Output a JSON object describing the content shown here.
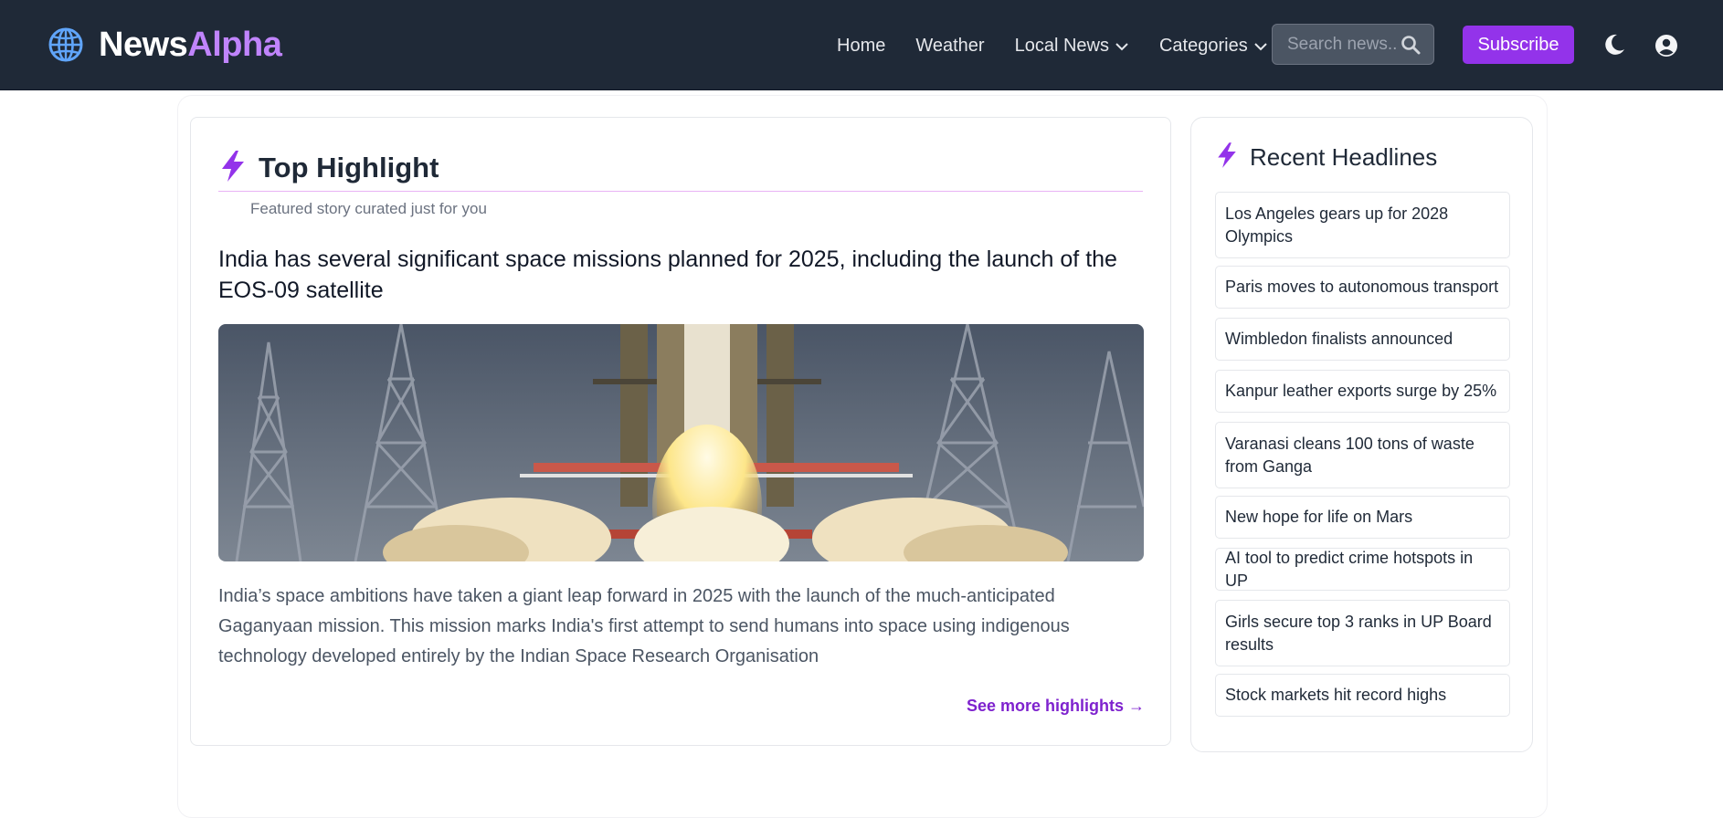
{
  "header": {
    "brand": {
      "part1": "News",
      "part2": "Alpha",
      "icon": "globe-icon"
    },
    "nav": [
      {
        "label": "Home",
        "dropdown": false
      },
      {
        "label": "Weather",
        "dropdown": false
      },
      {
        "label": "Local News",
        "dropdown": true
      },
      {
        "label": "Categories",
        "dropdown": true
      }
    ],
    "search_placeholder": "Search news...",
    "subscribe_label": "Subscribe",
    "icons": {
      "theme": "moon-icon",
      "account": "user-circle-icon",
      "search": "search-icon"
    }
  },
  "main": {
    "section_title": "Top Highlight",
    "section_subtitle": "Featured story curated just for you",
    "story": {
      "title": "India has several significant space missions planned for 2025, including the launch of the EOS-09 satellite",
      "image": "rocket-launch-photo",
      "body": "India’s space ambitions have taken a giant leap forward in 2025 with the launch of the much-anticipated Gaganyaan mission. This mission marks India's first attempt to send humans into space using indigenous technology developed entirely by the Indian Space Research Organisation"
    },
    "see_more_label": "See more highlights →"
  },
  "sidebar": {
    "title": "Recent Headlines",
    "headlines": [
      "Los Angeles gears up for 2028 Olympics",
      "Paris moves to autonomous transport",
      "Wimbledon finalists announced",
      "Kanpur leather exports surge by 25%",
      "Varanasi cleans 100 tons of waste from Ganga",
      "New hope for life on Mars",
      "AI tool to predict crime hotspots in UP",
      "Girls secure top 3 ranks in UP Board results",
      "Stock markets hit record highs"
    ]
  },
  "colors": {
    "header_bg": "#1f2937",
    "accent": "#9333ea",
    "brand_accent": "#c084fc",
    "link": "#7e22ce"
  }
}
